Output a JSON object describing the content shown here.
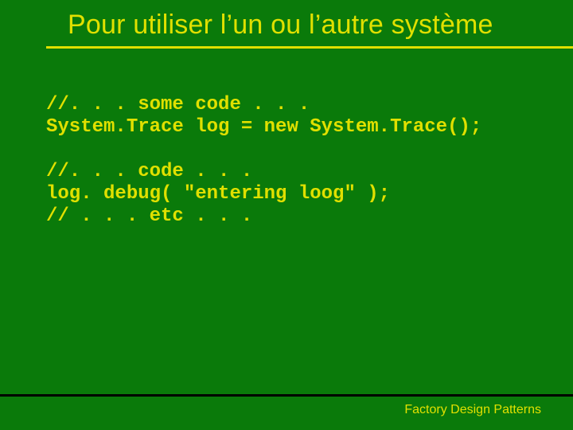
{
  "title": "Pour utiliser l’un ou l’autre système",
  "code": "//. . . some code . . .\nSystem.Trace log = new System.Trace();\n\n//. . . code . . .\nlog. debug( \"entering loog\" );\n// . . . etc . . .",
  "footer": "Factory Design Patterns"
}
